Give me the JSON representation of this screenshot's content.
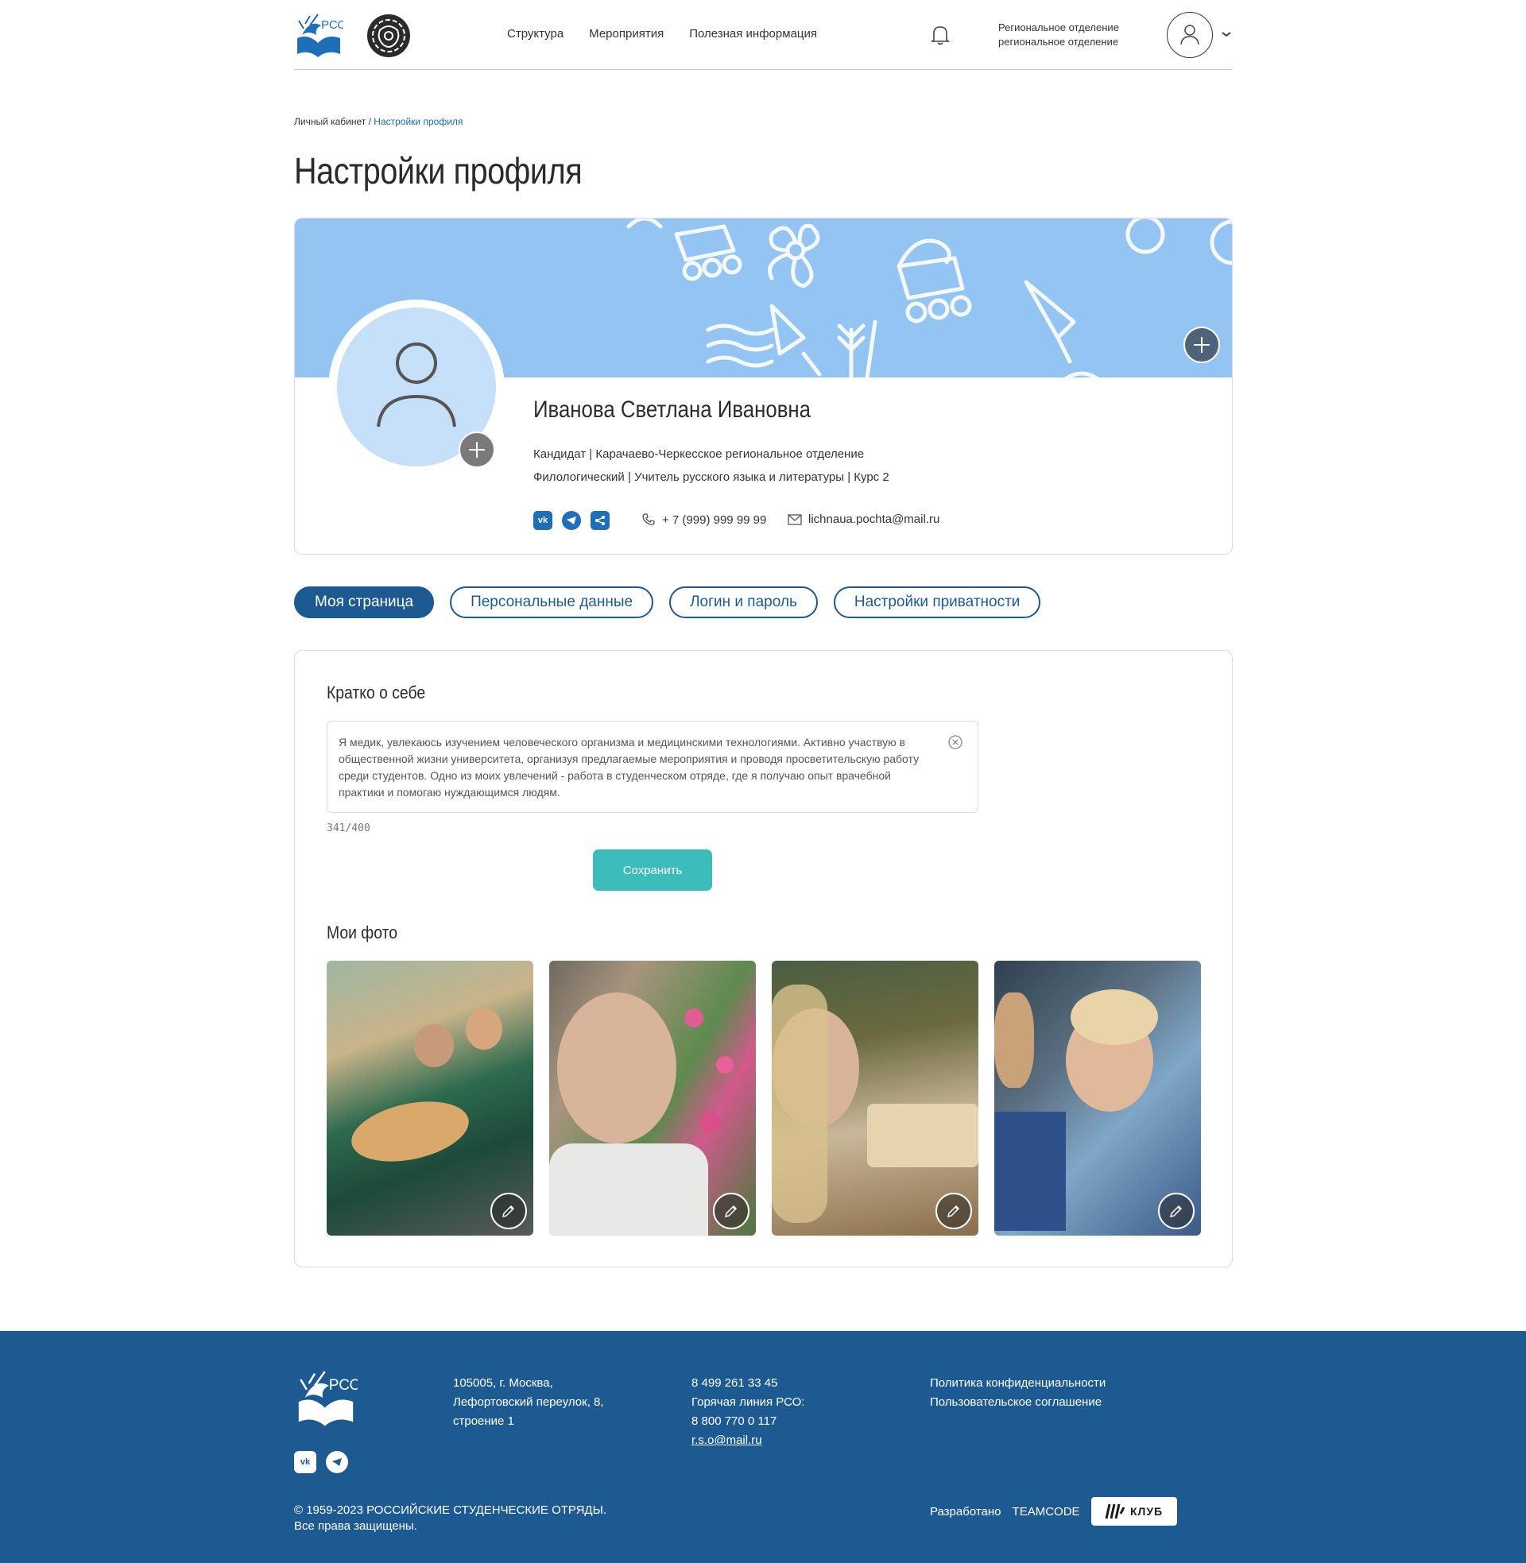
{
  "header": {
    "logo_text": "РСО",
    "nav": [
      "Структура",
      "Мероприятия",
      "Полезная информация"
    ],
    "region_line1": "Региональное отделение",
    "region_line2": "региональное отделение"
  },
  "breadcrumb": {
    "root": "Личный кабинет",
    "separator": " / ",
    "current": "Настройки профиля"
  },
  "page_title": "Настройки профиля",
  "profile": {
    "name": "Иванова Светлана Ивановна",
    "line1": "Кандидат  |  Карачаево-Черкесское региональное отделение",
    "line2": "Филологический  |  Учитель русского языка и литературы |  Курс 2",
    "phone": "+ 7 (999) 999 99 99",
    "email": "lichnaua.pochta@mail.ru",
    "socials": [
      "vk-icon",
      "telegram-icon",
      "share-icon"
    ]
  },
  "tabs": [
    {
      "label": "Моя страница",
      "active": true
    },
    {
      "label": "Персональные данные",
      "active": false
    },
    {
      "label": "Логин и пароль",
      "active": false
    },
    {
      "label": "Настройки приватности",
      "active": false
    }
  ],
  "about": {
    "title": "Кратко о себе",
    "text": "Я медик, увлекаюсь изучением человеческого организма и медицинскими технологиями. Активно участвую в общественной жизни университета, организуя предлагаемые мероприятия и проводя просветительскую работу среди студентов. Одно из моих увлечений - работа в студенческом отряде, где я получаю опыт врачебной практики и помогаю нуждающимся людям.",
    "counter": "341/400",
    "save_label": "Сохранить"
  },
  "photos": {
    "title": "Мои фото",
    "count": 4
  },
  "footer": {
    "logo_text": "РСО",
    "address": [
      "105005, г. Москва,",
      "Лефортовский переулок, 8,",
      "строение 1"
    ],
    "contacts": [
      "8 499 261 33 45",
      "Горячая линия РСО:",
      "8 800 770 0 117",
      "r.s.o@mail.ru"
    ],
    "links": [
      "Политика конфиденциальности",
      "Пользовательское соглашение"
    ],
    "copyright1": "© 1959-2023 РОССИЙСКИЕ СТУДЕНЧЕСКИЕ ОТРЯДЫ.",
    "copyright2": "Все права защищены.",
    "dev_label": "Разработано",
    "dev_name": "TEAMCODE",
    "club_label": "КЛУБ"
  },
  "colors": {
    "primary": "#1d5a92",
    "accent": "#3cbcbb",
    "cover": "#93c4f2",
    "link": "#1d6cb0"
  }
}
